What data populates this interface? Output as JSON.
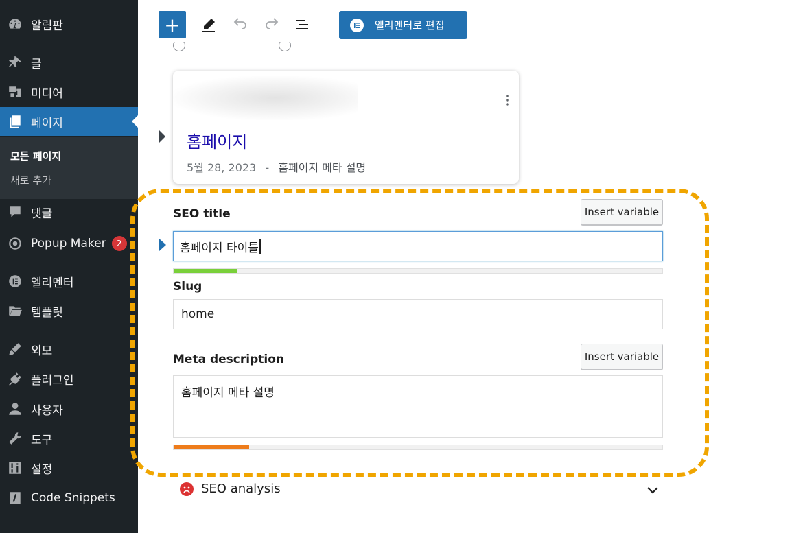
{
  "sidebar": {
    "items": [
      {
        "label": "알림판",
        "icon": "dashboard-icon"
      },
      {
        "label": "글",
        "icon": "pin-icon"
      },
      {
        "label": "미디어",
        "icon": "media-icon"
      },
      {
        "label": "페이지",
        "icon": "pages-icon",
        "active": true
      },
      {
        "label": "댓글",
        "icon": "comments-icon"
      },
      {
        "label": "Popup Maker",
        "icon": "popup-maker-icon",
        "badge": "2"
      },
      {
        "label": "엘리멘터",
        "icon": "elementor-icon"
      },
      {
        "label": "템플릿",
        "icon": "folder-icon"
      },
      {
        "label": "외모",
        "icon": "brush-icon"
      },
      {
        "label": "플러그인",
        "icon": "plugin-icon"
      },
      {
        "label": "사용자",
        "icon": "user-icon"
      },
      {
        "label": "도구",
        "icon": "wrench-icon"
      },
      {
        "label": "설정",
        "icon": "settings-icon"
      },
      {
        "label": "Code Snippets",
        "icon": "code-icon"
      }
    ],
    "submenu": [
      {
        "label": "모든 페이지",
        "current": true
      },
      {
        "label": "새로 추가"
      }
    ]
  },
  "toolbar": {
    "add_label": "+",
    "elementor_label": "엘리멘터로 편집"
  },
  "preview": {
    "title": "홈페이지",
    "date": "5월 28, 2023",
    "separator": "-",
    "description": "홈페이지 메타 설명"
  },
  "form": {
    "seo_title_label": "SEO title",
    "seo_title_value": "홈페이지 타이틀",
    "insert_variable": "Insert variable",
    "slug_label": "Slug",
    "slug_value": "home",
    "meta_label": "Meta description",
    "meta_value": "홈페이지 메타 설명",
    "title_progress": 0.13,
    "meta_progress": 0.155,
    "colors": {
      "good": "#7ad03a",
      "warn": "#ee7c1b",
      "highlight": "#f0a500",
      "accent": "#2271b1"
    }
  },
  "analysis": {
    "label": "SEO analysis",
    "status": "bad"
  }
}
